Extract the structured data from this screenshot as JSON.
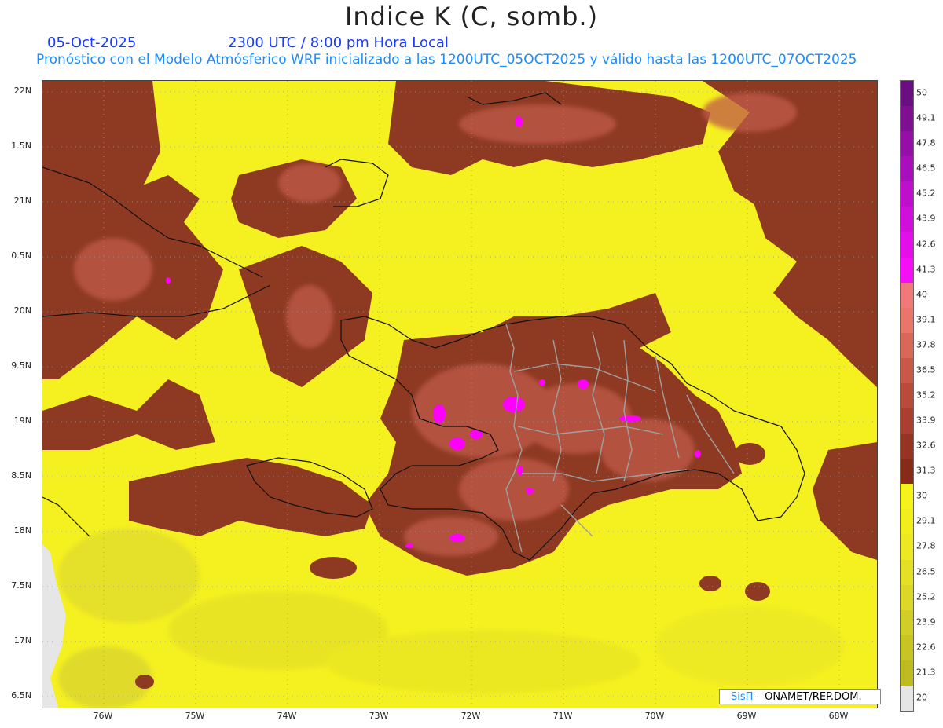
{
  "header": {
    "title": "Indice K (C, somb.)",
    "date": "05-Oct-2025",
    "time": "2300 UTC / 8:00 pm Hora Local",
    "description": "Pronóstico con el Modelo Atmósferico WRF inicializado a las 1200UTC_05OCT2025 y válido hasta las  1200UTC_07OCT2025"
  },
  "axes": {
    "lat_labels": [
      "22N",
      "1.5N",
      "21N",
      "0.5N",
      "20N",
      "9.5N",
      "19N",
      "8.5N",
      "18N",
      "7.5N",
      "17N",
      "6.5N"
    ],
    "lon_labels": [
      "76W",
      "75W",
      "74W",
      "73W",
      "72W",
      "71W",
      "70W",
      "69W",
      "68W"
    ]
  },
  "legend": {
    "levels": [
      "50",
      "49.1",
      "47.8",
      "46.5",
      "45.2",
      "43.9",
      "42.6",
      "41.3",
      "40",
      "39.1",
      "37.8",
      "36.5",
      "35.2",
      "33.9",
      "32.6",
      "31.3",
      "30",
      "29.1",
      "27.8",
      "26.5",
      "25.2",
      "23.9",
      "22.6",
      "21.3",
      "20"
    ],
    "colors": [
      "#6a0f80",
      "#7d0f90",
      "#930fa6",
      "#a80fba",
      "#bd0fcc",
      "#d10fdc",
      "#e20fe8",
      "#f50ff5",
      "#f07a7a",
      "#e8766a",
      "#d8685a",
      "#c8594a",
      "#b84b3c",
      "#a83f30",
      "#963424",
      "#862b18",
      "#f6f21c",
      "#f2ee1e",
      "#ece824",
      "#e4e028",
      "#dcd82a",
      "#d2ce28",
      "#c8c424",
      "#bebc20",
      "#e6e6e6"
    ]
  },
  "credit": {
    "brand": "SisΠ",
    "text": " – ONAMET/REP.DOM."
  },
  "colors": {
    "background_field": "#f5f020",
    "high_k": "#8e3a22",
    "very_high_k": "#c05a4a",
    "extreme_k": "#ff00ff",
    "land": "#e6e6e6"
  }
}
